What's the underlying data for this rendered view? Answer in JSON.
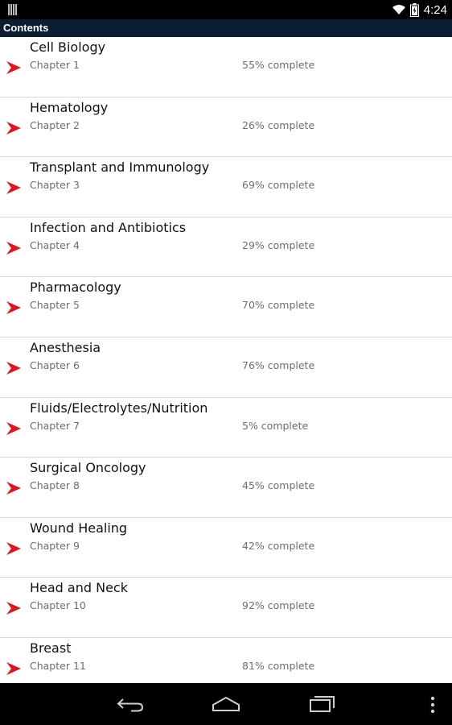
{
  "status_bar": {
    "time": "4:24",
    "icons": [
      "barcode-icon",
      "wifi-icon",
      "battery-icon"
    ]
  },
  "header": {
    "title": "Contents"
  },
  "chapters": [
    {
      "title": "Cell Biology",
      "chapter": "Chapter 1",
      "progress": "55% complete"
    },
    {
      "title": "Hematology",
      "chapter": "Chapter 2",
      "progress": "26% complete"
    },
    {
      "title": "Transplant and Immunology",
      "chapter": "Chapter 3",
      "progress": "69% complete"
    },
    {
      "title": "Infection and Antibiotics",
      "chapter": "Chapter 4",
      "progress": "29% complete"
    },
    {
      "title": "Pharmacology",
      "chapter": "Chapter 5",
      "progress": "70% complete"
    },
    {
      "title": "Anesthesia",
      "chapter": "Chapter 6",
      "progress": "76% complete"
    },
    {
      "title": "Fluids/Electrolytes/Nutrition",
      "chapter": "Chapter 7",
      "progress": "5% complete"
    },
    {
      "title": "Surgical Oncology",
      "chapter": "Chapter 8",
      "progress": "45% complete"
    },
    {
      "title": "Wound Healing",
      "chapter": "Chapter 9",
      "progress": "42% complete"
    },
    {
      "title": "Head and Neck",
      "chapter": "Chapter 10",
      "progress": "92% complete"
    },
    {
      "title": "Breast",
      "chapter": "Chapter 11",
      "progress": "81% complete"
    }
  ],
  "nav_bar": {
    "icons": [
      "back-icon",
      "home-icon",
      "recent-apps-icon",
      "overflow-menu-icon"
    ]
  },
  "colors": {
    "header_background": "#0b1e33",
    "arrow": "#e0141e",
    "status_bar": "#000000"
  }
}
